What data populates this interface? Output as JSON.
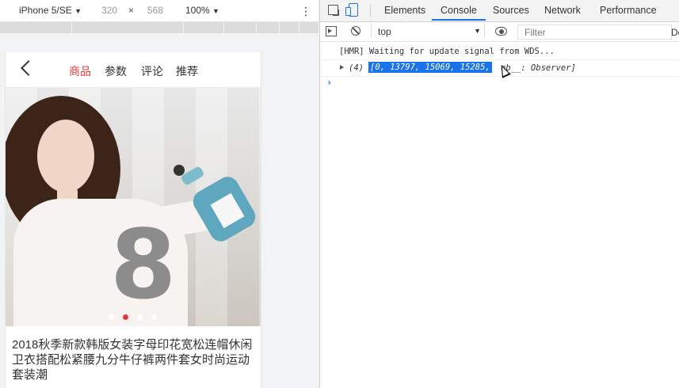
{
  "device_toolbar": {
    "device": "iPhone 5/SE",
    "width": "320",
    "times": "×",
    "height": "568",
    "zoom": "100%",
    "caret": "▼",
    "menu": "⋮"
  },
  "phone": {
    "tabs": [
      {
        "label": "商品",
        "active": true
      },
      {
        "label": "参数",
        "active": false
      },
      {
        "label": "评论",
        "active": false
      },
      {
        "label": "推荐",
        "active": false
      }
    ],
    "carousel_count": 4,
    "carousel_active_index": 1,
    "product_title": "2018秋季新款韩版女装字母印花宽松连帽休闲卫衣搭配松紧腰九分牛仔裤两件套女时尚运动套装潮",
    "accent_color": "#e4393c"
  },
  "devtools": {
    "tabs": [
      "Elements",
      "Console",
      "Sources",
      "Network",
      "Performance"
    ],
    "active_tab": "Console",
    "context": "top",
    "filter_placeholder": "Filter",
    "levels_label": "De",
    "console": {
      "hmr_message": "[HMR] Waiting for update signal from WDS...",
      "array_count": "(4)",
      "array_values": "[0, 13797, 15069, 15285, ",
      "array_suffix": "ob__: Observer]",
      "prompt": "›"
    },
    "accent_color": "#1a73e8"
  }
}
